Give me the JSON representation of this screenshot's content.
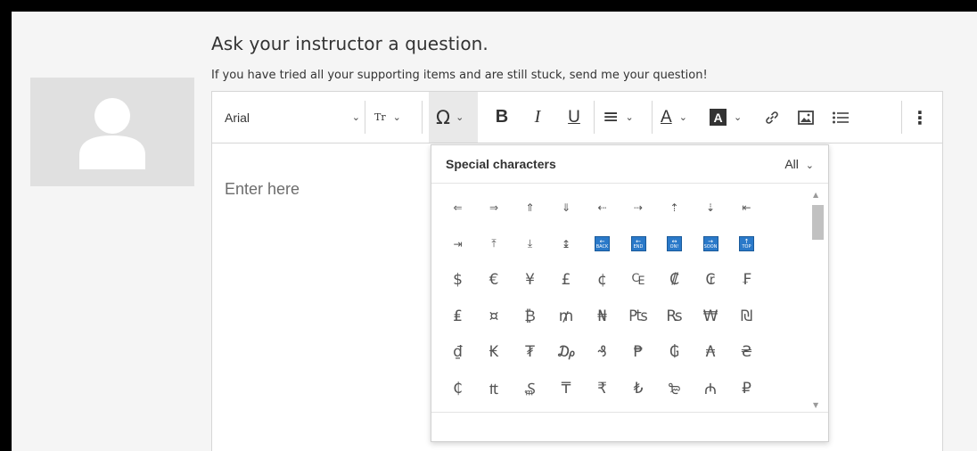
{
  "page": {
    "title": "Ask your instructor a question.",
    "subtitle": "If you have tried all your supporting items and are still stuck, send me your question!"
  },
  "toolbar": {
    "font_family": "Arial",
    "text_size_icon": "Tr",
    "special_chars_icon": "Ω",
    "bold": "B",
    "italic": "I",
    "underline": "U",
    "align_icon": "≡",
    "text_color_icon": "A",
    "bg_color_icon": "A",
    "link_icon": "link-icon",
    "image_icon": "image-icon",
    "list_icon": "list-icon",
    "more_icon": "⋮"
  },
  "editor": {
    "placeholder": "Enter here"
  },
  "special_chars": {
    "title": "Special characters",
    "filter": "All",
    "rows": [
      [
        "⇐",
        "⇒",
        "⇑",
        "⇓",
        "⇠",
        "⇢",
        "⇡",
        "⇣",
        "⇤"
      ],
      [
        "⇥",
        "⤒",
        "⤓",
        "↨",
        "BACK",
        "END",
        "ON!",
        "SOON",
        "TOP"
      ],
      [
        "$",
        "€",
        "¥",
        "£",
        "¢",
        "₠",
        "₡",
        "₢",
        "₣"
      ],
      [
        "₤",
        "¤",
        "₿",
        "₥",
        "₦",
        "₧",
        "₨",
        "₩",
        "₪"
      ],
      [
        "₫",
        "₭",
        "₮",
        "₯",
        "₰",
        "₱",
        "₲",
        "₳",
        "₴"
      ],
      [
        "₵",
        "₶",
        "₷",
        "₸",
        "₹",
        "₺",
        "₻",
        "₼",
        "₽"
      ]
    ]
  }
}
